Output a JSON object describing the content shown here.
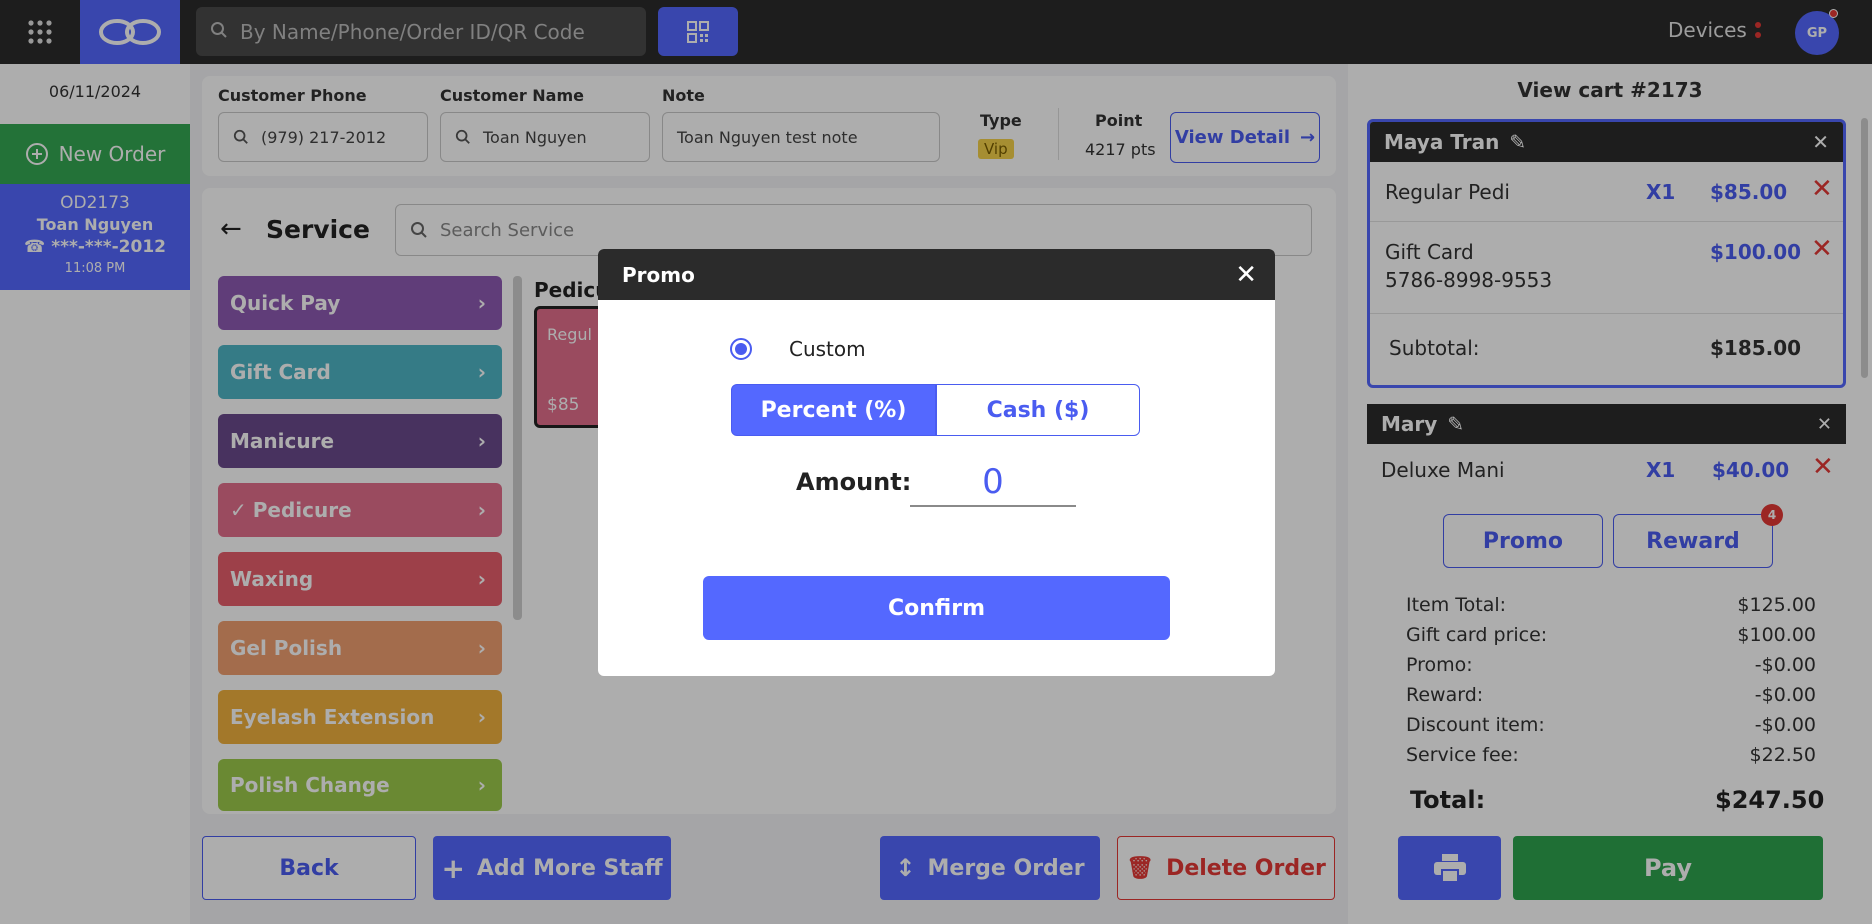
{
  "topbar": {
    "search_placeholder": "By Name/Phone/Order ID/QR Code",
    "devices_label": "Devices",
    "avatar_initials": "GP"
  },
  "sidebar": {
    "date": "06/11/2024",
    "new_order_label": "New Order",
    "order": {
      "id": "OD2173",
      "customer": "Toan Nguyen",
      "phone": "***-***-2012",
      "time": "11:08 PM"
    }
  },
  "customer": {
    "phone_label": "Customer Phone",
    "phone_value": "(979) 217-2012",
    "name_label": "Customer Name",
    "name_value": "Toan Nguyen",
    "note_label": "Note",
    "note_value": "Toan Nguyen test note",
    "type_label": "Type",
    "type_value": "Vip",
    "point_label": "Point",
    "point_value": "4217 pts",
    "view_detail_label": "View Detail"
  },
  "service": {
    "title": "Service",
    "search_placeholder": "Search Service",
    "group_title": "Pedicu",
    "tile_name": "Regul",
    "tile_price": "$85",
    "categories": [
      {
        "label": "Quick Pay",
        "color": "#8e5bb3"
      },
      {
        "label": "Gift Card",
        "color": "#4fb6c6"
      },
      {
        "label": "Manicure",
        "color": "#6b4a8c"
      },
      {
        "label": "Pedicure",
        "color": "#e36f8d"
      },
      {
        "label": "Waxing",
        "color": "#e85f6c"
      },
      {
        "label": "Gel Polish",
        "color": "#f0a070"
      },
      {
        "label": "Eyelash Extension",
        "color": "#f1b23f"
      },
      {
        "label": "Polish Change",
        "color": "#9ccb4c"
      }
    ]
  },
  "bottom": {
    "back_label": "Back",
    "add_staff_label": "Add More Staff",
    "merge_label": "Merge Order",
    "delete_label": "Delete Order"
  },
  "cart": {
    "title": "View cart #2173",
    "staff1": {
      "name": "Maya Tran",
      "item1_name": "Regular Pedi",
      "item1_qty": "X1",
      "item1_price": "$85.00",
      "item2_name": "Gift Card",
      "item2_code": "5786-8998-9553",
      "item2_price": "$100.00",
      "subtotal_label": "Subtotal:",
      "subtotal_value": "$185.00"
    },
    "staff2": {
      "name": "Mary",
      "item1_name": "Deluxe Mani",
      "item1_qty": "X1",
      "item1_price": "$40.00"
    },
    "promo_label": "Promo",
    "reward_label": "Reward",
    "reward_badge": "4",
    "totals": [
      {
        "label": "Item Total:",
        "value": "$125.00"
      },
      {
        "label": "Gift card price:",
        "value": "$100.00"
      },
      {
        "label": "Promo:",
        "value": "-$0.00"
      },
      {
        "label": "Reward:",
        "value": "-$0.00"
      },
      {
        "label": "Discount item:",
        "value": "-$0.00"
      },
      {
        "label": "Service fee:",
        "value": "$22.50"
      }
    ],
    "total_label": "Total:",
    "total_value": "$247.50",
    "pay_label": "Pay"
  },
  "modal": {
    "title": "Promo",
    "option_label": "Custom",
    "percent_label": "Percent (%)",
    "cash_label": "Cash ($)",
    "amount_label": "Amount:",
    "amount_value": "0",
    "confirm_label": "Confirm"
  }
}
